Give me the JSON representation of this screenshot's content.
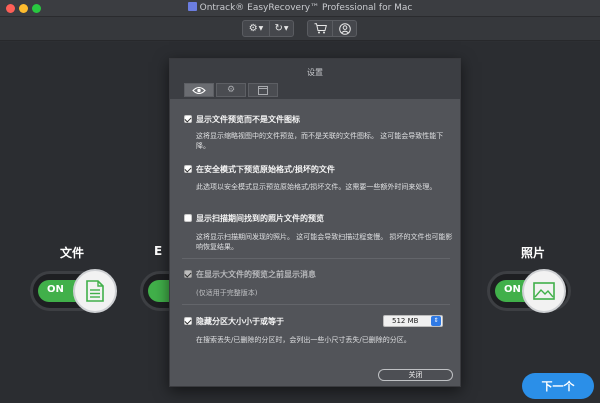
{
  "window": {
    "title": "Ontrack® EasyRecovery™ Professional for Mac"
  },
  "toolbar": {
    "buttons": [
      {
        "icon": "gear-icon",
        "label": "⚙ ▾"
      },
      {
        "icon": "history-icon",
        "label": "↻ ▾"
      },
      {
        "icon": "cart-icon"
      },
      {
        "icon": "user-icon"
      }
    ]
  },
  "stage": {
    "left_label": "文件",
    "left_partial_label": "E",
    "right_label": "照片",
    "toggle_on_text": "ON",
    "next_button": "下一个"
  },
  "settings": {
    "title": "设置",
    "tabs": [
      {
        "icon": "eye-icon",
        "active": true
      },
      {
        "icon": "gear-icon",
        "active": false
      },
      {
        "icon": "window-icon",
        "active": false
      }
    ],
    "options": [
      {
        "label": "显示文件预览而不是文件图标",
        "checked": true,
        "disabled": false,
        "description": "这将显示缩略视图中的文件预览，而不是关联的文件图标。 这可能会导致性能下降。"
      },
      {
        "label": "在安全模式下预览原始格式/损坏的文件",
        "checked": true,
        "disabled": false,
        "description": "此选项以安全模式显示预览原始格式/损坏文件。这需要一些额外时间来处理。"
      },
      {
        "label": "显示扫描期间找到的照片文件的预览",
        "checked": false,
        "disabled": false,
        "description": "这将显示扫描期间发现的照片。 这可能会导致扫描过程变慢。 损坏的文件也可能影响恢复结果。"
      },
      {
        "label": "在显示大文件的预览之前显示消息",
        "checked": true,
        "disabled": true,
        "description": "(仅适用于完整版本)"
      },
      {
        "label": "隐藏分区大小小于或等于",
        "checked": true,
        "disabled": false,
        "description": "在搜索丢失/已删除的分区时，会列出一些小尺寸丢失/已删除的分区。"
      }
    ],
    "size_value": "512 MB",
    "close_button": "关闭"
  },
  "colors": {
    "accent_green": "#41b04a",
    "next_blue": "#2b8fe8",
    "dialog_bg": "#525459"
  }
}
